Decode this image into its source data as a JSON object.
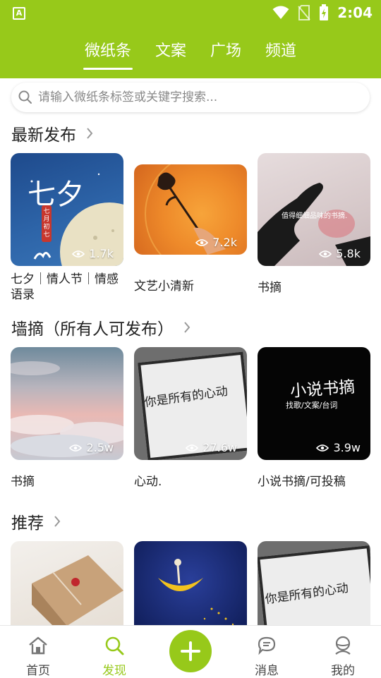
{
  "status": {
    "time": "2:04",
    "app_badge": "A"
  },
  "tabs": [
    {
      "label": "微纸条",
      "active": true
    },
    {
      "label": "文案",
      "active": false
    },
    {
      "label": "广场",
      "active": false
    },
    {
      "label": "频道",
      "active": false
    }
  ],
  "search": {
    "placeholder": "请输入微纸条标签或关键字搜索..."
  },
  "sections": {
    "latest": {
      "title": "最新发布",
      "cards": [
        {
          "caption": "七夕｜情人节｜情感语录",
          "views": "1.7k",
          "overlay_text": [
            "七夕",
            "七月初七"
          ]
        },
        {
          "caption": "文艺小清新",
          "views": "7.2k"
        },
        {
          "caption": "书摘",
          "views": "5.8k",
          "overlay_text": [
            "值得细细品味的书摘."
          ]
        }
      ]
    },
    "wall": {
      "title": "墙摘（所有人可发布）",
      "cards": [
        {
          "caption": "书摘",
          "views": "2.5w"
        },
        {
          "caption": "心动.",
          "views": "27.6w",
          "overlay_text": [
            "你是所有的心动"
          ]
        },
        {
          "caption": "小说书摘/可投稿",
          "views": "3.9w",
          "overlay_text": [
            "小说书摘",
            "找歌/文案/台词"
          ]
        }
      ]
    },
    "recommend": {
      "title": "推荐",
      "cards": [
        {
          "caption": "",
          "views": ""
        },
        {
          "caption": "",
          "views": ""
        },
        {
          "caption": "",
          "views": "",
          "overlay_text": [
            "你是所有的心动"
          ]
        }
      ]
    }
  },
  "bottom_nav": [
    {
      "label": "首页",
      "icon": "home-icon",
      "active": false
    },
    {
      "label": "发现",
      "icon": "search-icon",
      "active": true
    },
    {
      "label": "",
      "icon": "plus-icon",
      "active": false
    },
    {
      "label": "消息",
      "icon": "message-icon",
      "active": false
    },
    {
      "label": "我的",
      "icon": "user-icon",
      "active": false
    }
  ],
  "colors": {
    "brand": "#97c91a"
  }
}
